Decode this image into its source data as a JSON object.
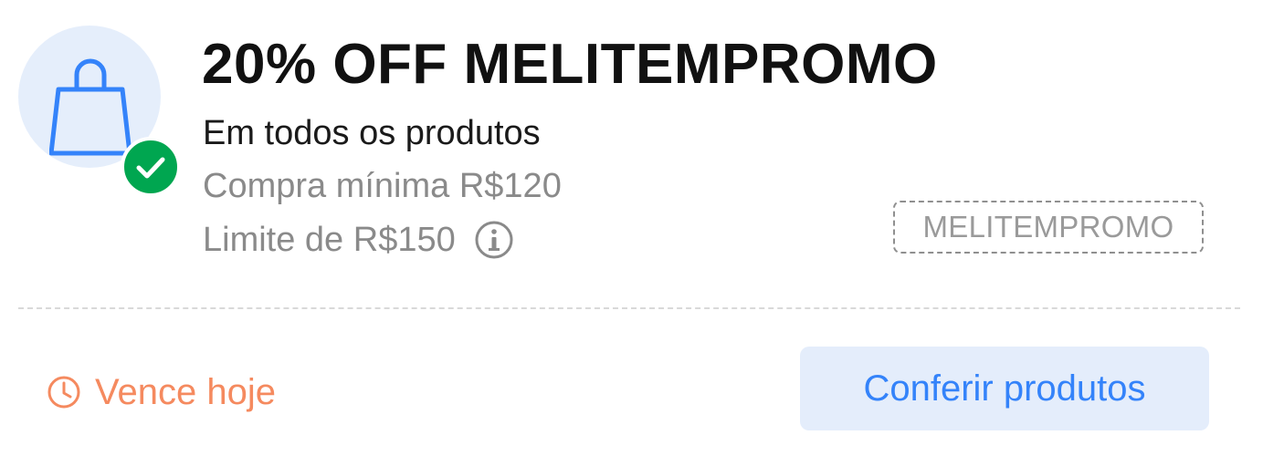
{
  "coupon": {
    "title": "20% OFF MELITEMPROMO",
    "subtitle": "Em todos os produtos",
    "min_purchase": "Compra mínima R$120",
    "limit": "Limite de R$150",
    "code": "MELITEMPROMO",
    "expiry": "Vence hoje",
    "cta_label": "Conferir produtos"
  },
  "icons": {
    "bag": "shopping-bag-icon",
    "check": "check-circle-icon",
    "info": "info-icon",
    "clock": "clock-icon"
  },
  "colors": {
    "icon_bg": "#e5eefb",
    "bag_stroke": "#3483fa",
    "check_green": "#00a650",
    "expiry_orange": "#f58a5f",
    "cta_bg": "#e4edfb",
    "cta_text": "#3483fa",
    "muted_text": "#8a8a8a"
  }
}
